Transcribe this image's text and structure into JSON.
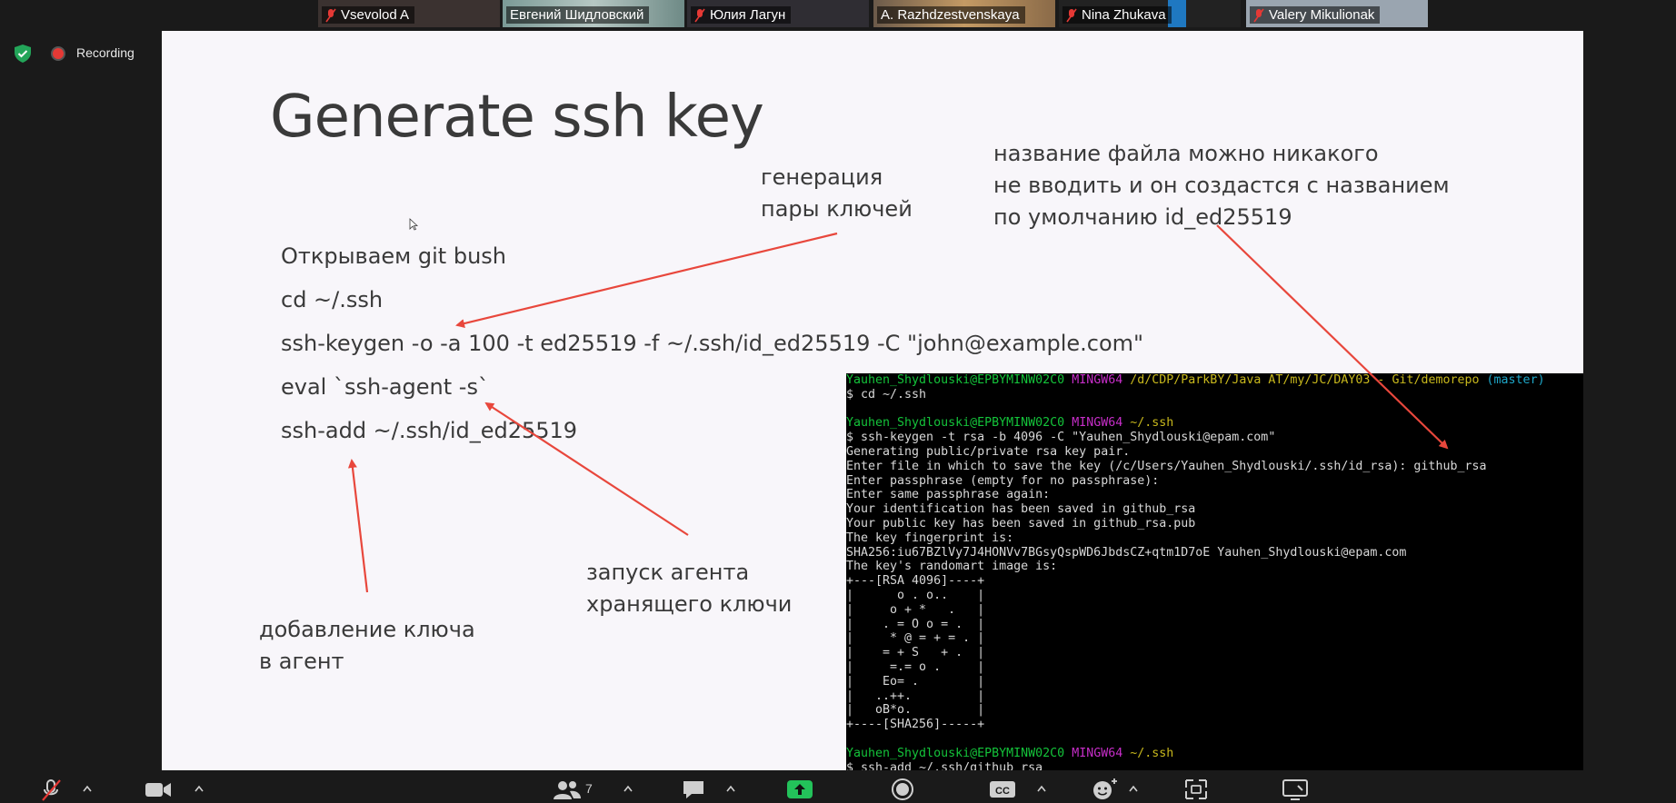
{
  "participants": [
    {
      "name": "Vsevolod A",
      "muted": true,
      "bg": "#3b3230"
    },
    {
      "name": "Евгений Шидловский",
      "muted": false,
      "bg": "#8aa6a2"
    },
    {
      "name": "Юлия Лагун",
      "muted": true,
      "bg": "#2f2d33"
    },
    {
      "name": "A. Razhdzestvenskaya",
      "muted": false,
      "bg": "#a9825a"
    },
    {
      "name": "Nina Zhukava",
      "muted": true,
      "bg": "#2a6f9a"
    },
    {
      "name": "Valery Mikulionak",
      "muted": true,
      "bg": "#9aa5b0"
    }
  ],
  "status": {
    "recording_label": "Recording"
  },
  "slide": {
    "title": "Generate ssh key",
    "commands": [
      "Открываем git bush",
      "cd   ~/.ssh",
      "ssh-keygen  -o   -a  100   -t   ed25519  -f   ~/.ssh/id_ed25519   -C   \"john@example.com\"",
      "eval `ssh-agent   -s`",
      "ssh-add   ~/.ssh/id_ed25519"
    ],
    "note_keygen": [
      "генерация",
      "пары ключей"
    ],
    "note_filename": [
      "название файла можно никакого",
      "не вводить и он создастся с названием",
      "по умолчанию id_ed25519"
    ],
    "note_agent": [
      "запуск агента",
      "хранящего ключи"
    ],
    "note_add": [
      "добавление ключа",
      "в агент"
    ]
  },
  "terminal": {
    "user_host": "Yauhen_Shydlouski@EPBYMINW02C0",
    "shell": "MINGW64",
    "path1": "/d/CDP/ParkBY/Java AT/my/JC/DAY03 - Git/demorepo",
    "branch": "(master)",
    "path2": "~/.ssh",
    "lines": [
      "$ cd ~/.ssh",
      "",
      "$ ssh-keygen -t rsa -b 4096 -C \"Yauhen_Shydlouski@epam.com\"",
      "Generating public/private rsa key pair.",
      "Enter file in which to save the key (/c/Users/Yauhen_Shydlouski/.ssh/id_rsa): github_rsa",
      "Enter passphrase (empty for no passphrase):",
      "Enter same passphrase again:",
      "Your identification has been saved in github_rsa",
      "Your public key has been saved in github_rsa.pub",
      "The key fingerprint is:",
      "SHA256:iu67BZlVy7J4HONVv7BGsyQspWD6JbdsCZ+qtm1D7oE Yauhen_Shydlouski@epam.com",
      "The key's randomart image is:",
      "+---[RSA 4096]----+",
      "|      o . o..    |",
      "|     o + *   .   |",
      "|    . = O o = .  |",
      "|     * @ = + = . |",
      "|    = + S   + .  |",
      "|     =.= o .     |",
      "|    Eo= .        |",
      "|   ..++.         |",
      "|   oB*o.         |",
      "+----[SHA256]-----+",
      "",
      "$ ssh-add ~/.ssh/github_rsa"
    ]
  },
  "toolbar": {
    "participants_count": "7"
  }
}
